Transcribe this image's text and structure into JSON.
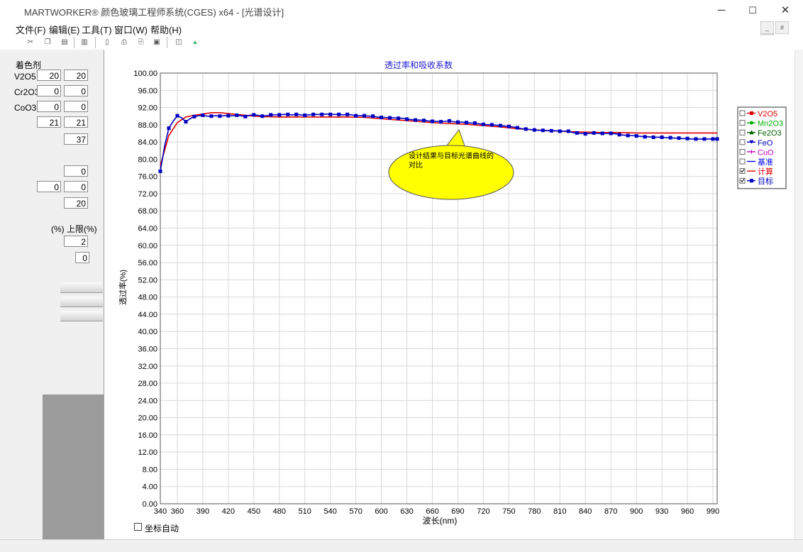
{
  "window": {
    "title": "MARTWORKER® 颜色玻璃工程师系统(CGES) x64  - [光谱设计]",
    "minimize": "─",
    "maximize": "☐",
    "close": "✕"
  },
  "menu": [
    "文件(F)",
    "编辑(E)",
    "工具(T)",
    "窗口(W)",
    "帮助(H)"
  ],
  "mdi_buttons": [
    "_",
    "#",
    "×"
  ],
  "toolbar_icons": [
    "cut-icon",
    "copy-icon",
    "paste-icon",
    "doc-icon",
    "new-icon",
    "print-icon",
    "print-preview-icon",
    "save-icon",
    "window-icon",
    "chart-icon"
  ],
  "left_panel": {
    "section_label": "着色剂",
    "rows": [
      {
        "name": "V2O5",
        "v1": "20",
        "v2": "20"
      },
      {
        "name": "Cr2O3",
        "v1": "0",
        "v2": "0"
      },
      {
        "name": "CoO3",
        "v1": "0",
        "v2": "0"
      },
      {
        "name": "",
        "v1": "21",
        "v2": "21"
      }
    ],
    "single_values": [
      "37",
      "0",
      "0",
      "0",
      "20"
    ],
    "limit_header": "(%) 上限(%)",
    "limit_values": [
      "2",
      "0"
    ]
  },
  "chart_data": {
    "type": "line",
    "title": "透过率和吸收系数",
    "xlabel": "波长(nm)",
    "ylabel": "透过率(%)",
    "xlim": [
      340,
      995
    ],
    "ylim": [
      0,
      100
    ],
    "x_ticks": [
      340,
      360,
      390,
      420,
      450,
      480,
      510,
      540,
      570,
      600,
      630,
      660,
      690,
      720,
      750,
      780,
      810,
      840,
      870,
      900,
      930,
      960,
      990
    ],
    "y_ticks": [
      0,
      4,
      8,
      12,
      16,
      20,
      24,
      28,
      32,
      36,
      40,
      44,
      48,
      52,
      56,
      60,
      64,
      68,
      72,
      76,
      80,
      84,
      88,
      92,
      96,
      100
    ],
    "grid": true,
    "legend_position": "right",
    "legend": [
      {
        "name": "V2O5",
        "color": "#e00000",
        "checked": false,
        "marker": "square"
      },
      {
        "name": "Mn2O3",
        "color": "#00b000",
        "checked": false,
        "marker": "circle"
      },
      {
        "name": "Fe2O3",
        "color": "#006000",
        "checked": false,
        "marker": "triangle"
      },
      {
        "name": "FeO",
        "color": "#0000c0",
        "checked": false,
        "marker": "triangle-down"
      },
      {
        "name": "CuO",
        "color": "#c000c0",
        "checked": false,
        "marker": "plus"
      },
      {
        "name": "基准",
        "color": "#0000ff",
        "checked": false,
        "marker": "none"
      },
      {
        "name": "计算",
        "color": "#e00000",
        "checked": true,
        "marker": "none"
      },
      {
        "name": "目标",
        "color": "#0000c0",
        "checked": true,
        "marker": "square"
      }
    ],
    "callout": "设计结果与目标光谱曲线的对比",
    "series": [
      {
        "name": "计算",
        "color": "#e00000",
        "x": [
          340,
          350,
          360,
          370,
          380,
          390,
          400,
          410,
          420,
          430,
          440,
          450,
          460,
          480,
          500,
          520,
          540,
          560,
          580,
          600,
          620,
          640,
          660,
          680,
          700,
          720,
          740,
          760,
          780,
          800,
          820,
          840,
          860,
          880,
          900,
          920,
          940,
          960,
          980,
          995
        ],
        "values": [
          78.5,
          85.5,
          88.5,
          89.8,
          90.2,
          90.5,
          90.8,
          90.8,
          90.6,
          90.4,
          90.2,
          90.0,
          89.9,
          89.8,
          89.8,
          89.8,
          89.8,
          89.8,
          89.7,
          89.4,
          89.1,
          88.8,
          88.5,
          88.3,
          88.1,
          87.8,
          87.5,
          87.1,
          86.8,
          86.6,
          86.4,
          86.3,
          86.2,
          86.2,
          86.1,
          86.1,
          86.1,
          86.1,
          86.1,
          86.1
        ]
      },
      {
        "name": "目标",
        "color": "#0000c0",
        "x": [
          340,
          345,
          350,
          355,
          360,
          365,
          370,
          375,
          380,
          385,
          390,
          395,
          400,
          405,
          410,
          415,
          420,
          425,
          430,
          435,
          440,
          445,
          450,
          455,
          460,
          465,
          470,
          475,
          480,
          485,
          490,
          495,
          500,
          505,
          510,
          515,
          520,
          525,
          530,
          535,
          540,
          545,
          550,
          555,
          560,
          565,
          570,
          575,
          580,
          585,
          590,
          595,
          600,
          605,
          610,
          615,
          620,
          625,
          630,
          635,
          640,
          645,
          650,
          655,
          660,
          665,
          670,
          675,
          680,
          685,
          690,
          695,
          700,
          705,
          710,
          715,
          720,
          725,
          730,
          735,
          740,
          745,
          750,
          755,
          760,
          765,
          770,
          775,
          780,
          785,
          790,
          795,
          800,
          805,
          810,
          815,
          820,
          825,
          830,
          835,
          840,
          845,
          850,
          855,
          860,
          865,
          870,
          875,
          880,
          885,
          890,
          895,
          900,
          905,
          910,
          915,
          920,
          925,
          930,
          935,
          940,
          945,
          950,
          955,
          960,
          965,
          970,
          975,
          980,
          985,
          990,
          995
        ],
        "values": [
          77.2,
          83.0,
          87.2,
          88.8,
          90.1,
          89.6,
          88.7,
          89.4,
          89.9,
          90.1,
          90.2,
          90.0,
          90.0,
          90.1,
          90.0,
          90.1,
          90.1,
          90.1,
          90.2,
          90.1,
          89.9,
          90.2,
          90.3,
          90.2,
          90.0,
          90.1,
          90.3,
          90.3,
          90.3,
          90.4,
          90.4,
          90.3,
          90.4,
          90.3,
          90.2,
          90.3,
          90.4,
          90.4,
          90.4,
          90.5,
          90.4,
          90.4,
          90.4,
          90.3,
          90.4,
          90.3,
          90.1,
          90.1,
          90.1,
          90.0,
          90.0,
          89.8,
          89.7,
          89.7,
          89.6,
          89.6,
          89.5,
          89.5,
          89.3,
          89.2,
          89.1,
          89.1,
          89.0,
          88.9,
          88.8,
          88.8,
          88.7,
          88.8,
          88.9,
          88.7,
          88.6,
          88.6,
          88.5,
          88.4,
          88.4,
          88.2,
          88.1,
          88.0,
          88.0,
          87.9,
          87.8,
          87.7,
          87.6,
          87.5,
          87.3,
          87.1,
          87.0,
          86.9,
          86.8,
          86.7,
          86.7,
          86.6,
          86.6,
          86.6,
          86.5,
          86.5,
          86.5,
          86.2,
          86.1,
          86.0,
          85.9,
          86.0,
          86.1,
          86.0,
          86.0,
          86.0,
          86.0,
          85.9,
          85.7,
          85.6,
          85.5,
          85.5,
          85.4,
          85.3,
          85.2,
          85.2,
          85.1,
          85.1,
          85.1,
          85.0,
          85.0,
          84.9,
          84.9,
          84.8,
          84.8,
          84.7,
          84.7,
          84.7,
          84.7,
          84.7,
          84.7,
          84.7
        ]
      }
    ]
  },
  "chart_controls": {
    "auto_axis_label": "坐标自动"
  }
}
